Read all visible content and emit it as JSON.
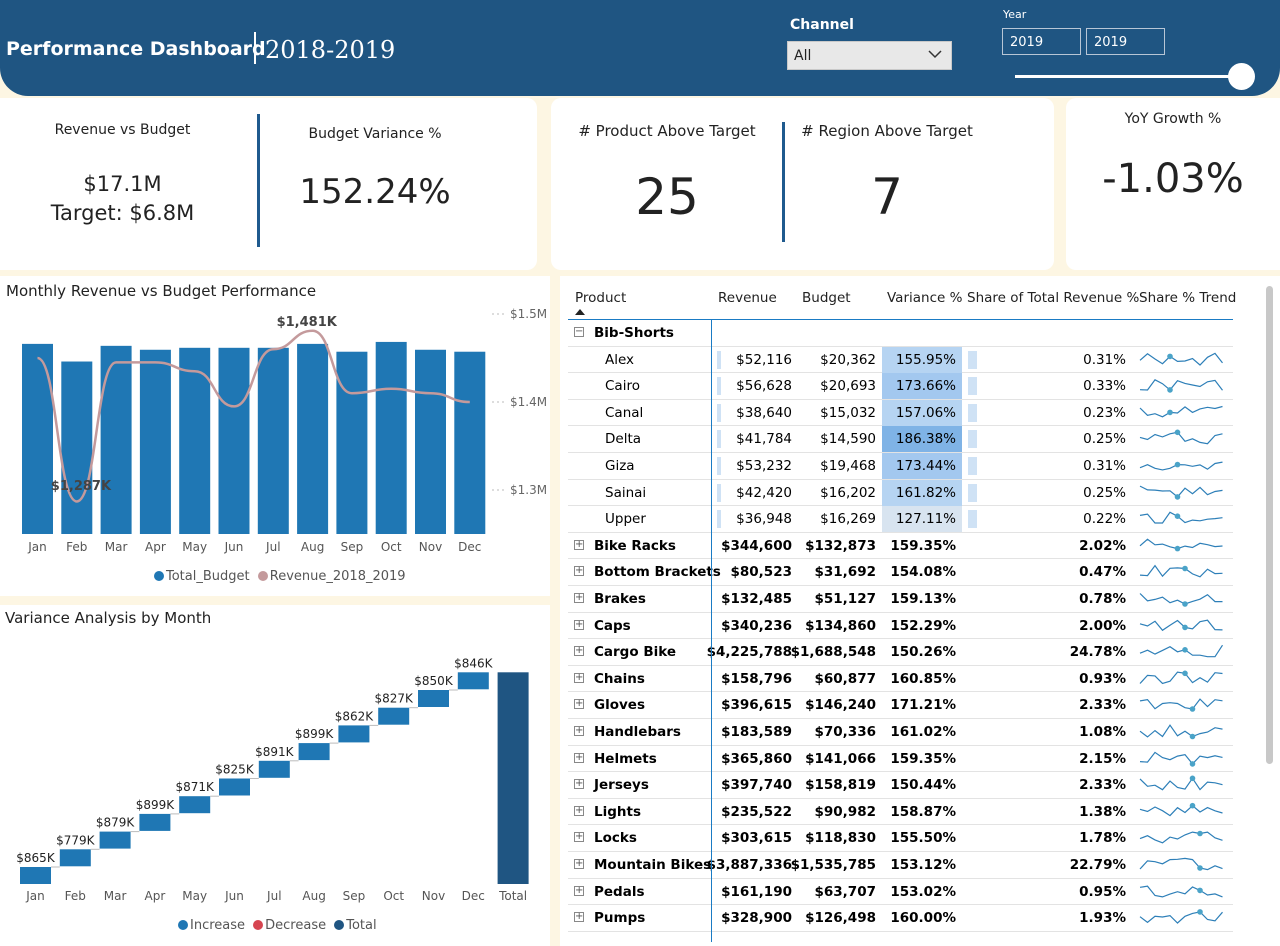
{
  "header": {
    "title": "Performance Dashboard",
    "years": "2018-2019",
    "channel_label": "Channel",
    "channel_value": "All",
    "year_label": "Year",
    "year_from": "2019",
    "year_to": "2019"
  },
  "kpis": {
    "rev_budget_label": "Revenue vs Budget",
    "rev_value": "$17.1M",
    "target_value": "Target: $6.8M",
    "budget_var_label": "Budget Variance %",
    "budget_var_value": "152.24%",
    "prod_above_label": "# Product Above Target",
    "prod_above_value": "25",
    "region_above_label": "# Region Above Target",
    "region_above_value": "7",
    "yoy_label": "YoY Growth %",
    "yoy_value": "-1.03%"
  },
  "monthly_chart_title": "Monthly Revenue vs Budget Performance",
  "variance_chart_title": "Variance Analysis by Month",
  "chart_data": [
    {
      "type": "bar",
      "title": "Monthly Revenue vs Budget Performance",
      "categories": [
        "Jan",
        "Feb",
        "Mar",
        "Apr",
        "May",
        "Jun",
        "Jul",
        "Aug",
        "Sep",
        "Oct",
        "Nov",
        "Dec"
      ],
      "y_ticks": [
        "$1.5M",
        "$1.4M",
        "$1.3M"
      ],
      "series": [
        {
          "name": "Total_Budget",
          "kind": "bar",
          "color": "#1f77b4",
          "values": [
            0.97,
            0.88,
            0.96,
            0.94,
            0.95,
            0.95,
            0.95,
            0.97,
            0.93,
            0.98,
            0.94,
            0.93
          ]
        },
        {
          "name": "Revenue_2018_2019",
          "kind": "line",
          "color": "#c49a9c",
          "values": [
            1.45,
            1.287,
            1.445,
            1.445,
            1.435,
            1.395,
            1.46,
            1.481,
            1.41,
            1.415,
            1.41,
            1.4
          ]
        }
      ],
      "data_labels": [
        {
          "index": 7,
          "text": "$1,481K"
        },
        {
          "index": 1,
          "text": "$1,287K"
        }
      ],
      "legend": [
        "Total_Budget",
        "Revenue_2018_2019"
      ],
      "legend_position": "bottom"
    },
    {
      "type": "waterfall",
      "title": "Variance Analysis by Month",
      "categories": [
        "Jan",
        "Feb",
        "Mar",
        "Apr",
        "May",
        "Jun",
        "Jul",
        "Aug",
        "Sep",
        "Oct",
        "Nov",
        "Dec",
        "Total"
      ],
      "values": [
        865,
        779,
        879,
        899,
        871,
        825,
        891,
        899,
        862,
        827,
        850,
        846
      ],
      "labels": [
        "$865K",
        "$779K",
        "$879K",
        "$899K",
        "$871K",
        "$825K",
        "$891K",
        "$899K",
        "$862K",
        "$827K",
        "$850K",
        "$846K"
      ],
      "legend": [
        "Increase",
        "Decrease",
        "Total"
      ],
      "legend_position": "bottom",
      "colors": {
        "increase": "#1f77b4",
        "decrease": "#d64550",
        "total": "#1f5582"
      }
    }
  ],
  "table": {
    "headers": [
      "Product",
      "Revenue",
      "Budget",
      "Variance %",
      "Share of Total Revenue %",
      "Share % Trend"
    ],
    "rows": [
      {
        "name": "Bib-Shorts",
        "level": 0,
        "expanded": true,
        "revenue": "",
        "budget": "",
        "variance": "",
        "share": ""
      },
      {
        "name": "Alex",
        "level": 1,
        "revenue": "$52,116",
        "budget": "$20,362",
        "variance": "155.95%",
        "share": "0.31%"
      },
      {
        "name": "Cairo",
        "level": 1,
        "revenue": "$56,628",
        "budget": "$20,693",
        "variance": "173.66%",
        "share": "0.33%"
      },
      {
        "name": "Canal",
        "level": 1,
        "revenue": "$38,640",
        "budget": "$15,032",
        "variance": "157.06%",
        "share": "0.23%"
      },
      {
        "name": "Delta",
        "level": 1,
        "revenue": "$41,784",
        "budget": "$14,590",
        "variance": "186.38%",
        "share": "0.25%"
      },
      {
        "name": "Giza",
        "level": 1,
        "revenue": "$53,232",
        "budget": "$19,468",
        "variance": "173.44%",
        "share": "0.31%"
      },
      {
        "name": "Sainai",
        "level": 1,
        "revenue": "$42,420",
        "budget": "$16,202",
        "variance": "161.82%",
        "share": "0.25%"
      },
      {
        "name": "Upper",
        "level": 1,
        "revenue": "$36,948",
        "budget": "$16,269",
        "variance": "127.11%",
        "share": "0.22%"
      },
      {
        "name": "Bike Racks",
        "level": 0,
        "revenue": "$344,600",
        "budget": "$132,873",
        "variance": "159.35%",
        "share": "2.02%"
      },
      {
        "name": "Bottom Brackets",
        "level": 0,
        "revenue": "$80,523",
        "budget": "$31,692",
        "variance": "154.08%",
        "share": "0.47%"
      },
      {
        "name": "Brakes",
        "level": 0,
        "revenue": "$132,485",
        "budget": "$51,127",
        "variance": "159.13%",
        "share": "0.78%"
      },
      {
        "name": "Caps",
        "level": 0,
        "revenue": "$340,236",
        "budget": "$134,860",
        "variance": "152.29%",
        "share": "2.00%"
      },
      {
        "name": "Cargo Bike",
        "level": 0,
        "revenue": "$4,225,788",
        "budget": "$1,688,548",
        "variance": "150.26%",
        "share": "24.78%"
      },
      {
        "name": "Chains",
        "level": 0,
        "revenue": "$158,796",
        "budget": "$60,877",
        "variance": "160.85%",
        "share": "0.93%"
      },
      {
        "name": "Gloves",
        "level": 0,
        "revenue": "$396,615",
        "budget": "$146,240",
        "variance": "171.21%",
        "share": "2.33%"
      },
      {
        "name": "Handlebars",
        "level": 0,
        "revenue": "$183,589",
        "budget": "$70,336",
        "variance": "161.02%",
        "share": "1.08%"
      },
      {
        "name": "Helmets",
        "level": 0,
        "revenue": "$365,860",
        "budget": "$141,066",
        "variance": "159.35%",
        "share": "2.15%"
      },
      {
        "name": "Jerseys",
        "level": 0,
        "revenue": "$397,740",
        "budget": "$158,819",
        "variance": "150.44%",
        "share": "2.33%"
      },
      {
        "name": "Lights",
        "level": 0,
        "revenue": "$235,522",
        "budget": "$90,982",
        "variance": "158.87%",
        "share": "1.38%"
      },
      {
        "name": "Locks",
        "level": 0,
        "revenue": "$303,615",
        "budget": "$118,830",
        "variance": "155.50%",
        "share": "1.78%"
      },
      {
        "name": "Mountain Bikes",
        "level": 0,
        "revenue": "$3,887,336",
        "budget": "$1,535,785",
        "variance": "153.12%",
        "share": "22.79%"
      },
      {
        "name": "Pedals",
        "level": 0,
        "revenue": "$161,190",
        "budget": "$63,707",
        "variance": "153.02%",
        "share": "0.95%"
      },
      {
        "name": "Pumps",
        "level": 0,
        "revenue": "$328,900",
        "budget": "$126,498",
        "variance": "160.00%",
        "share": "1.93%"
      }
    ]
  },
  "colors": {
    "header": "#1f5582",
    "bar": "#1f77b4",
    "line": "#c49a9c",
    "accent": "#1f5a8e"
  }
}
